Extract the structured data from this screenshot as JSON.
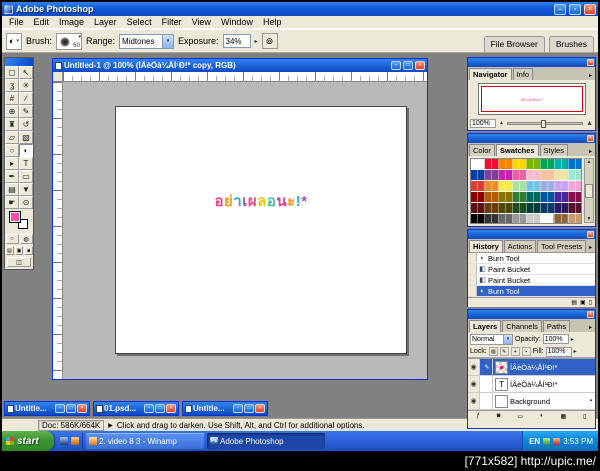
{
  "glyphs": {
    "minimize": "–",
    "maximize": "□",
    "restore": "▫",
    "close": "×",
    "menu_arrow": "▾",
    "flyout_arrow": "▸",
    "slider_arrow": "▶",
    "eye": "◉",
    "brush_indicator": "✎",
    "lock": "▪",
    "airbrush": "⊚",
    "mountain": "▲",
    "standard_mode": "○",
    "quickmask_mode": "◍",
    "screen_standard": "▤",
    "screen_menu": "▣",
    "screen_full": "■",
    "imageready": "◫",
    "ps_logo": "Ps"
  },
  "watermark": {
    "text": "[771x582] http://upic.me/"
  },
  "app": {
    "title": "Adobe Photoshop",
    "menus": [
      "File",
      "Edit",
      "Image",
      "Layer",
      "Select",
      "Filter",
      "View",
      "Window",
      "Help"
    ]
  },
  "options": {
    "brush_label": "Brush:",
    "brush_size": "60",
    "range_label": "Range:",
    "range_value": "Midtones",
    "exposure_label": "Exposure:",
    "exposure_value": "34%",
    "well_tabs": [
      "File Browser",
      "Brushes"
    ]
  },
  "tools": {
    "foreground_color": "#ff4fa8",
    "background_color": "#ffffff",
    "list": [
      {
        "name": "rectangular-marquee",
        "glyph": "◻"
      },
      {
        "name": "move",
        "glyph": "↖"
      },
      {
        "name": "lasso",
        "glyph": "ʓ"
      },
      {
        "name": "magic-wand",
        "glyph": "✳"
      },
      {
        "name": "crop",
        "glyph": "#"
      },
      {
        "name": "slice",
        "glyph": "∕"
      },
      {
        "name": "healing-brush",
        "glyph": "⊕"
      },
      {
        "name": "brush",
        "glyph": "✎"
      },
      {
        "name": "clone-stamp",
        "glyph": "♜"
      },
      {
        "name": "history-brush",
        "glyph": "↺"
      },
      {
        "name": "eraser",
        "glyph": "▱"
      },
      {
        "name": "gradient",
        "glyph": "▧"
      },
      {
        "name": "blur",
        "glyph": "○"
      },
      {
        "name": "burn",
        "glyph": "◐",
        "active": true
      },
      {
        "name": "path-selection",
        "glyph": "▸"
      },
      {
        "name": "type",
        "glyph": "T"
      },
      {
        "name": "pen",
        "glyph": "✒"
      },
      {
        "name": "shape",
        "glyph": "▭"
      },
      {
        "name": "notes",
        "glyph": "▤"
      },
      {
        "name": "eyedropper",
        "glyph": "▼"
      },
      {
        "name": "hand",
        "glyph": "☛"
      },
      {
        "name": "zoom",
        "glyph": "⊙"
      }
    ]
  },
  "document": {
    "title": "Untitled-1 @ 100% (ÍÂèÒà¼ÅÍ¹Ð!* copy, RGB)",
    "canvas_text": "อย่าเผลอนะ!*",
    "text_colors": [
      "#e8418c",
      "#f59a23",
      "#7bc043",
      "#29abe0",
      "#9b59b6",
      "#ef4b81",
      "#f2c50f",
      "#45c1a8",
      "#e8418c",
      "#f59a23",
      "#29abe0",
      "#9b59b6"
    ]
  },
  "navigator": {
    "tabs": [
      "Navigator",
      "Info"
    ],
    "zoom": "100%"
  },
  "colors_palette": {
    "tabs": [
      "Color",
      "Swatches",
      "Styles"
    ]
  },
  "history": {
    "tabs": [
      "History",
      "Actions",
      "Tool Presets"
    ],
    "items": [
      {
        "label": "Burn Tool",
        "glyph": "◐"
      },
      {
        "label": "Paint Bucket",
        "glyph": "◧"
      },
      {
        "label": "Paint Bucket",
        "glyph": "◧"
      },
      {
        "label": "Burn Tool",
        "glyph": "◐",
        "selected": true
      }
    ],
    "action_icons": [
      "▤",
      "▣",
      "▯"
    ]
  },
  "layers": {
    "tabs": [
      "Layers",
      "Channels",
      "Paths"
    ],
    "blend_mode": "Normal",
    "opacity_label": "Opacity:",
    "opacity_value": "100%",
    "lock_label": "Lock:",
    "fill_label": "Fill:",
    "fill_value": "100%",
    "lock_icons": [
      "▨",
      "✎",
      "+",
      "▪"
    ],
    "items": [
      {
        "name": "ÍÂèÒà¼ÅÍ¹Ð!*",
        "thumb": "",
        "selected": true
      },
      {
        "name": "ÍÂèÒà¼ÅÍ¹Ð!*",
        "thumb": "T"
      },
      {
        "name": "Background",
        "thumb": ""
      }
    ],
    "action_icons": [
      "ƒ",
      "◙",
      "▭",
      "◐",
      "▦",
      "▯"
    ]
  },
  "minimized_docs": [
    {
      "title": "Untitle..."
    },
    {
      "title": "01.psd..."
    },
    {
      "title": "Untitle..."
    }
  ],
  "status": {
    "doc_info": "Doc: 586K/664K",
    "hint": "Click and drag to darken. Use Shift, Alt, and Ctrl for additional options."
  },
  "taskbar": {
    "start_label": "start",
    "tasks": [
      {
        "title": "2. video 8 3 - Winamp"
      },
      {
        "title": "Adobe Photoshop",
        "active": true
      }
    ],
    "tray_lang": "EN",
    "time": "3:53 PM"
  }
}
